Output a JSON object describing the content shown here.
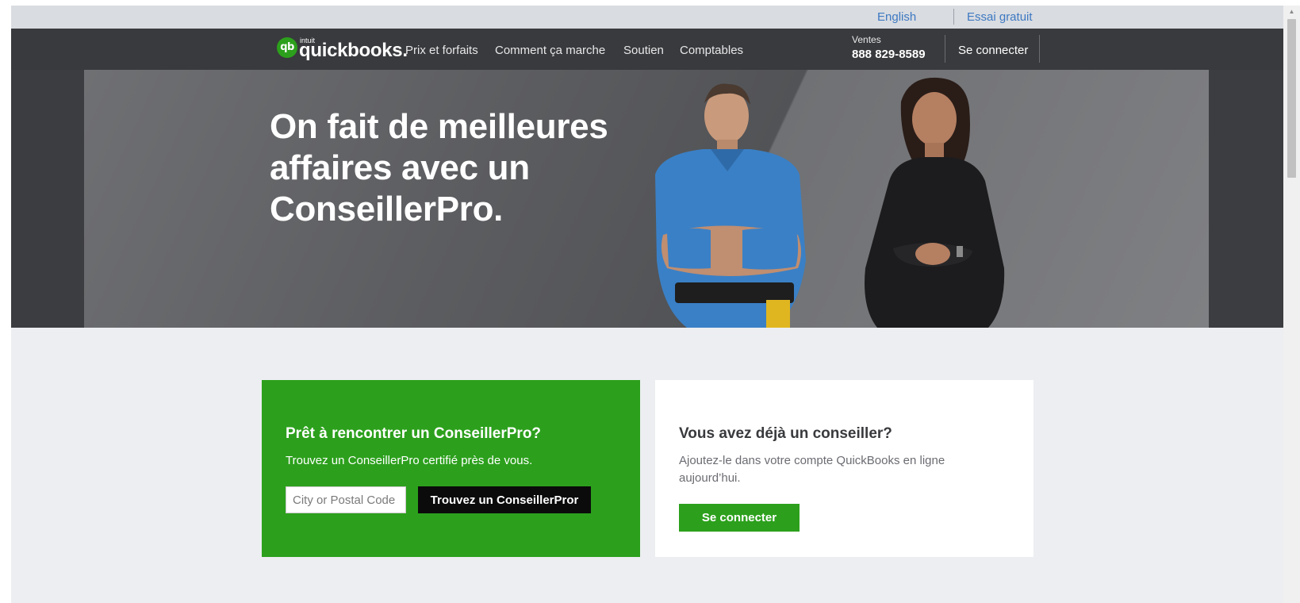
{
  "utility_bar": {
    "english_label": "English",
    "trial_label": "Essai gratuit"
  },
  "header": {
    "logo_badge": "qb",
    "logo_small": "intuit",
    "logo_text": "quickbooks.",
    "nav": {
      "pricing": "Prix et forfaits",
      "how": "Comment ça marche",
      "support": "Soutien",
      "accountants": "Comptables"
    },
    "sales_label": "Ventes",
    "sales_phone": "888 829-8589",
    "signin_label": "Se connecter"
  },
  "hero": {
    "title": "On fait de meilleures affaires avec un ConseillerPro."
  },
  "find_card": {
    "title": "Prêt à rencontrer un ConseillerPro?",
    "text": "Trouvez un ConseillerPro certifié près de vous.",
    "input_placeholder": "City or Postal Code",
    "button_label": "Trouvez un ConseillerPror"
  },
  "existing_card": {
    "title": "Vous avez déjà un conseiller?",
    "text": "Ajoutez-le dans votre compte QuickBooks en ligne aujourd’hui.",
    "button_label": "Se connecter"
  },
  "colors": {
    "brand_green": "#2ca01c",
    "header_dark": "#393a3d",
    "link_blue": "#3e79c2"
  }
}
